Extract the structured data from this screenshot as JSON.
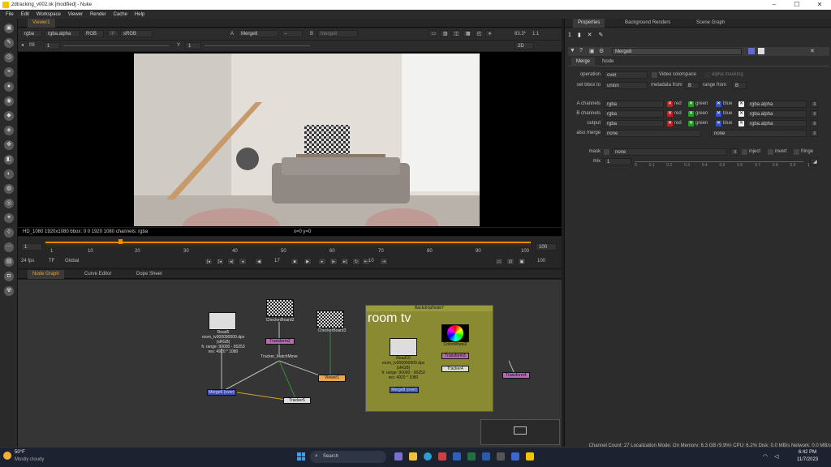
{
  "window": {
    "title": "2dtracking_v002.nk [modified] - Nuke"
  },
  "menu": [
    "File",
    "Edit",
    "Workspace",
    "Viewer",
    "Render",
    "Cache",
    "Help"
  ],
  "viewer": {
    "tab": "Viewer1",
    "channels": "rgba",
    "alpha": "rgba.alpha",
    "colorspace_rgb": "RGB",
    "ip": "IP",
    "display": "sRGB",
    "a_label": "A",
    "a_input": "Merge8",
    "b_label": "B",
    "b_input": "Merge8",
    "dash": "-",
    "zoom": "83.3*",
    "ratio": "1:1",
    "fstop": "f/8",
    "fval": "1",
    "y_label": "Y",
    "y_value": "1",
    "mode": "2D",
    "info": "HD_1080 1920x1080  bbox: 0 0 1920 1080 channels: rgba",
    "coords": "x=0 y=0"
  },
  "timeline": {
    "start": "1",
    "end": "100",
    "end2": "100",
    "ticks": [
      "1",
      "10",
      "20",
      "30",
      "40",
      "50",
      "60",
      "70",
      "80",
      "90",
      "100"
    ],
    "fps": "24 fps",
    "tf": "TF",
    "global": "Global",
    "frame": "17",
    "step": "10",
    "step_label": "10",
    "current_marker": 17
  },
  "graph_tabs": [
    "Node Graph",
    "Curve Editor",
    "Dope Sheet"
  ],
  "nodes": {
    "read5": {
      "title": "Read5",
      "l1": "room_tv000090000.dpx",
      "l2": "(sRGB)",
      "l3": "fr. range: 90000 - 90253",
      "l4": "res: 4920 * 1080"
    },
    "checker_a": "CheckerBoard2",
    "checker_b": "CheckerBoard3",
    "transform": "Transform2",
    "matchmove": "Tracker_MatchMove",
    "viewer1": "Viewer1",
    "merge_a": "Merge6 (over)",
    "tracker5": "Tracker5",
    "backdrop_title": "BackdropNode7",
    "backdrop_label": "room tv",
    "read10": {
      "title": "Read10",
      "l1": "room_tv000090000.dpx",
      "l2": "(sRGB)",
      "l3": "fr. range: 90000 - 90253",
      "l4": "res: 4920 * 1080"
    },
    "colorwheel": "ColorWheel2",
    "transform3": "Transform3",
    "tracker4": "Tracker4",
    "merge_b": "Merge8 (over)",
    "transform4": "Transform4"
  },
  "properties": {
    "tabs": [
      "Properties",
      "Background Renders",
      "Scene Graph"
    ],
    "node_name": "Merge8",
    "subtabs": [
      "Merge",
      "Node"
    ],
    "operation_label": "operation",
    "operation": "over",
    "video_colorspace": "Video colorspace",
    "alpha_masking": "alpha masking",
    "bbox_label": "set bbox to",
    "bbox": "union",
    "metadata_label": "metadata from",
    "metadata": "B",
    "range_label": "range from",
    "range": "B",
    "a_channels_label": "A channels",
    "a_channels": "rgba",
    "a_alpha": "rgba.alpha",
    "b_channels_label": "B channels",
    "b_channels": "rgba",
    "b_alpha": "rgba.alpha",
    "output_label": "output",
    "output": "rgba",
    "output_alpha": "rgba.alpha",
    "also_merge_label": "also merge",
    "also_merge": "none",
    "also_merge2": "none",
    "red": "red",
    "green": "green",
    "blue": "blue",
    "mask_label": "mask",
    "mask": "none",
    "inject": "inject",
    "invert": "invert",
    "fringe": "fringe",
    "mix_label": "mix",
    "mix": "1",
    "mix_ticks": [
      "0",
      "0.1",
      "0.2",
      "0.3",
      "0.4",
      "0.5",
      "0.6",
      "0.7",
      "0.8",
      "0.9",
      "1"
    ]
  },
  "status": "Channel Count: 27  Localization Mode: On  Memory: 6.3 GB (9.9%)  CPU: 6.2%  Disk: 0.0 MB/s  Network: 0.0 MB/s",
  "taskbar": {
    "weather_temp": "50°F",
    "weather_desc": "Mostly cloudy",
    "search": "Search",
    "time": "6:42 PM",
    "date": "11/7/2023"
  }
}
